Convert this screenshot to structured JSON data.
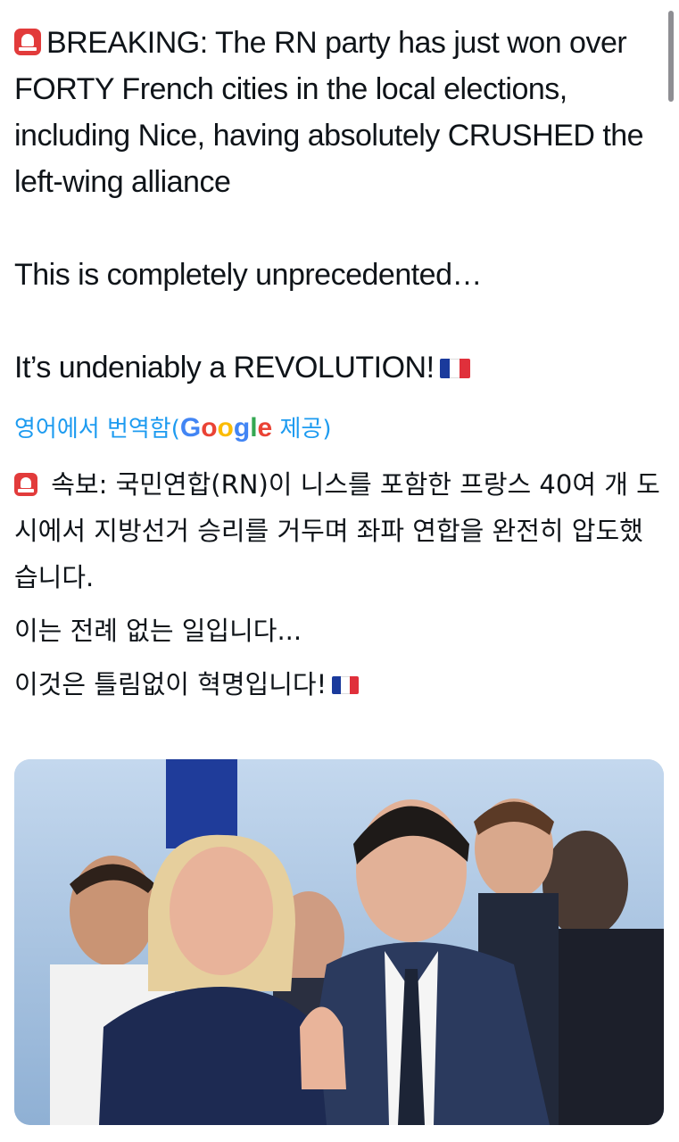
{
  "tweet": {
    "para1": "BREAKING: The RN party has just won over FORTY French cities in the local elections, including Nice, having absolutely CRUSHED the left-wing alliance",
    "para2": "This is completely unprecedented…",
    "para3": "It’s undeniably a REVOLUTION!",
    "icons": {
      "siren": "police-car-light-icon",
      "flag": "france-flag-icon"
    }
  },
  "translation": {
    "prefix": "영어에서 번역함(",
    "google_letters": [
      {
        "ch": "G",
        "color": "#4285F4"
      },
      {
        "ch": "o",
        "color": "#EA4335"
      },
      {
        "ch": "o",
        "color": "#FBBC05"
      },
      {
        "ch": "g",
        "color": "#4285F4"
      },
      {
        "ch": "l",
        "color": "#34A853"
      },
      {
        "ch": "e",
        "color": "#EA4335"
      }
    ],
    "suffix": " 제공)",
    "link_color": "#1d9bf0",
    "para1": "속보: 국민연합(RN)이 니스를 포함한 프랑스 40여 개 도시에서 지방선거 승리를 거두며 좌파 연합을 완전히 압도했습니다.",
    "para2": "이는 전례 없는 일입니다...",
    "para3": "이것은 틀림없이 혁명입니다!"
  },
  "media": {
    "type": "photo"
  }
}
